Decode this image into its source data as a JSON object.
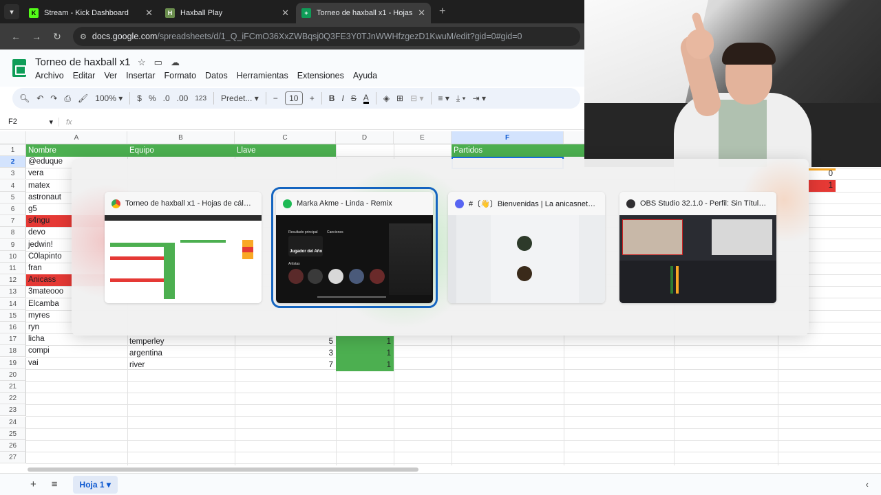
{
  "browser": {
    "tabs": [
      {
        "title": "Stream - Kick Dashboard",
        "icon": "kick-icon",
        "icon_letter": "K",
        "icon_color": "#53fc18"
      },
      {
        "title": "Haxball Play",
        "icon": "haxball-icon",
        "icon_letter": "H",
        "icon_color": "#6b8e4e"
      },
      {
        "title": "Torneo de haxball x1 - Hojas de",
        "icon": "sheets-icon",
        "icon_letter": "+",
        "icon_color": "#0f9d58"
      }
    ],
    "url_site": "docs.google.com",
    "url_path": "/spreadsheets/d/1_Q_iFCmO36XxZWBqsj0Q3FE3Y0TJnWWHfzgezD1KwuM/edit?gid=0#gid=0"
  },
  "doc": {
    "title": "Torneo de haxball x1",
    "menu": [
      "Archivo",
      "Editar",
      "Ver",
      "Insertar",
      "Formato",
      "Datos",
      "Herramientas",
      "Extensiones",
      "Ayuda"
    ]
  },
  "toolbar": {
    "zoom": "100%",
    "currency": "$",
    "percent": "%",
    "dec_less": ".0",
    "dec_more": ".00",
    "number_format": "123",
    "font": "Predet...",
    "font_size": "10",
    "bold": "B",
    "italic": "I"
  },
  "formula": {
    "cell_ref": "F2",
    "fx": "fx"
  },
  "columns": [
    "A",
    "B",
    "C",
    "D",
    "E",
    "F"
  ],
  "rows": [
    "1",
    "2",
    "3",
    "4",
    "5",
    "6",
    "7",
    "8",
    "9",
    "10",
    "11",
    "12",
    "13",
    "14",
    "15",
    "16",
    "17",
    "18",
    "19",
    "20",
    "21",
    "22",
    "23",
    "24",
    "25",
    "26",
    "27"
  ],
  "header_row": {
    "a": "Nombre",
    "b": "Equipo",
    "c": "Llave",
    "f": "Partidos"
  },
  "names": [
    "@eduque",
    "vera",
    "matex",
    "astronaut",
    "g5",
    "s4ngu",
    "devo",
    "jedwin!",
    "C0lapinto",
    "fran",
    "Anicass",
    "3mateooo",
    "Elcamba",
    "myres",
    "ryn",
    "licha",
    "compi",
    "vai"
  ],
  "visible_rows_bottom": [
    {
      "name": "licha",
      "team": "temperley",
      "llave": "5",
      "d": "1"
    },
    {
      "name": "compi",
      "team": "argentina",
      "llave": "3",
      "d": "1"
    },
    {
      "name": "vai",
      "team": "river",
      "llave": "7",
      "d": "1"
    }
  ],
  "right_values": {
    "zero": "0",
    "one": "1"
  },
  "sheet_tab": "Hoja 1",
  "switcher": {
    "cards": [
      {
        "title": "Torneo de haxball x1 - Hojas de cálculo...",
        "icon": "chrome-icon",
        "color": "#4285f4"
      },
      {
        "title": "Marka Akme - Linda - Remix",
        "icon": "spotify-icon",
        "color": "#1db954"
      },
      {
        "title": "#〔👋〕Bienvenidas | La anicasneta - Disc...",
        "icon": "discord-icon",
        "color": "#5865f2"
      },
      {
        "title": "OBS Studio 32.1.0 - Perfil: Sin Título - Esc...",
        "icon": "obs-icon",
        "color": "#302e31"
      }
    ],
    "spotify_labels": {
      "main": "Resultado principal",
      "songs": "Canciones",
      "artist": "Jugador del Año",
      "artists": "Artistas"
    }
  }
}
